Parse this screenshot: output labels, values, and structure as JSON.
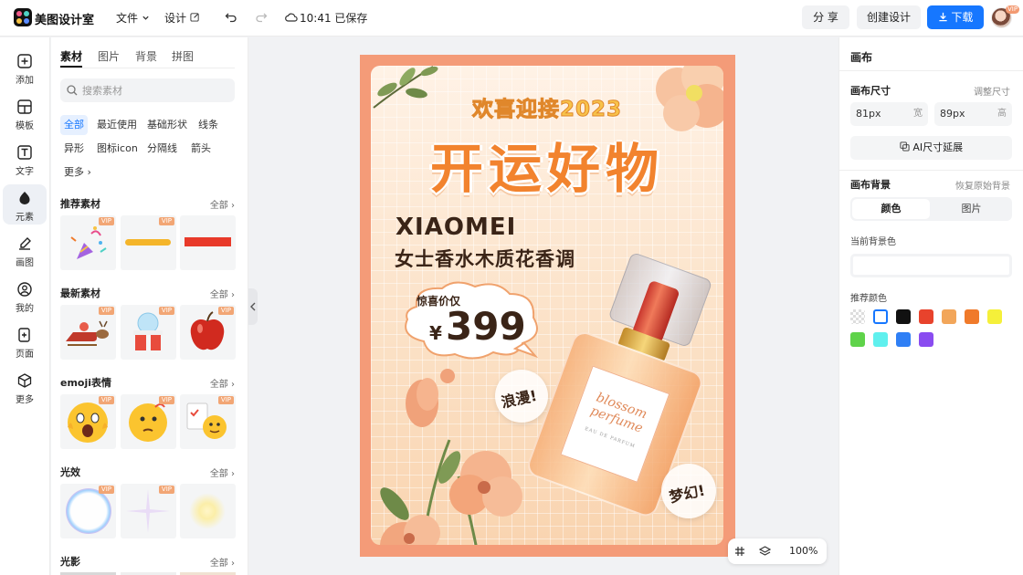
{
  "header": {
    "app_name": "美图设计室",
    "menu_file": "文件",
    "menu_design": "设计",
    "save_status": "10:41 已保存",
    "share": "分 享",
    "create": "创建设计",
    "download": "下载",
    "avatar_badge": "VIP"
  },
  "sidebar": {
    "items": [
      {
        "label": "添加",
        "icon": "plus-square-icon"
      },
      {
        "label": "模板",
        "icon": "template-icon"
      },
      {
        "label": "文字",
        "icon": "text-icon"
      },
      {
        "label": "元素",
        "icon": "element-icon"
      },
      {
        "label": "画图",
        "icon": "draw-icon"
      },
      {
        "label": "我的",
        "icon": "user-icon"
      },
      {
        "label": "页面",
        "icon": "page-icon"
      },
      {
        "label": "更多",
        "icon": "cube-icon"
      }
    ],
    "active_index": 3
  },
  "panel": {
    "tabs": [
      "素材",
      "图片",
      "背景",
      "拼图"
    ],
    "search_placeholder": "搜索素材",
    "chips": [
      "全部",
      "最近使用",
      "基础形状",
      "线条",
      "异形",
      "图标icon",
      "分隔线",
      "箭头",
      "更多"
    ],
    "view_all": "全部",
    "vip_label": "VIP",
    "sections": [
      {
        "title": "推荐素材"
      },
      {
        "title": "最新素材"
      },
      {
        "title": "emoji表情"
      },
      {
        "title": "光效"
      },
      {
        "title": "光影"
      }
    ]
  },
  "poster": {
    "headline_small": "欢喜迎接2023",
    "headline_big": "开运好物",
    "brand": "XIAOMEI",
    "product": "女士香水木质花香调",
    "price_label": "惊喜价仅",
    "currency": "¥",
    "price": "399",
    "tag1": "浪漫!",
    "tag2": "梦幻!",
    "bottle_text1": "blossom",
    "bottle_text2": "perfume",
    "bottle_text3": "EAU DE PARFUM"
  },
  "zoom": {
    "level": "100%"
  },
  "right_panel": {
    "title": "画布",
    "size_label": "画布尺寸",
    "adjust_size": "调整尺寸",
    "width_value": "81px",
    "width_unit": "宽",
    "height_value": "89px",
    "height_unit": "高",
    "ai_extend": "AI尺寸延展",
    "bg_label": "画布背景",
    "restore_bg": "恢复原始背景",
    "seg_color": "颜色",
    "seg_image": "图片",
    "current_bg_label": "当前背景色",
    "recommended_label": "推荐颜色",
    "colors": [
      "transparent",
      "#ffffff",
      "#111111",
      "#e8432c",
      "#f2a65a",
      "#f07a2a",
      "#f5f03a",
      "#5fd34a",
      "#5ff0ee",
      "#2f7ff5",
      "#8a4cf0"
    ]
  }
}
